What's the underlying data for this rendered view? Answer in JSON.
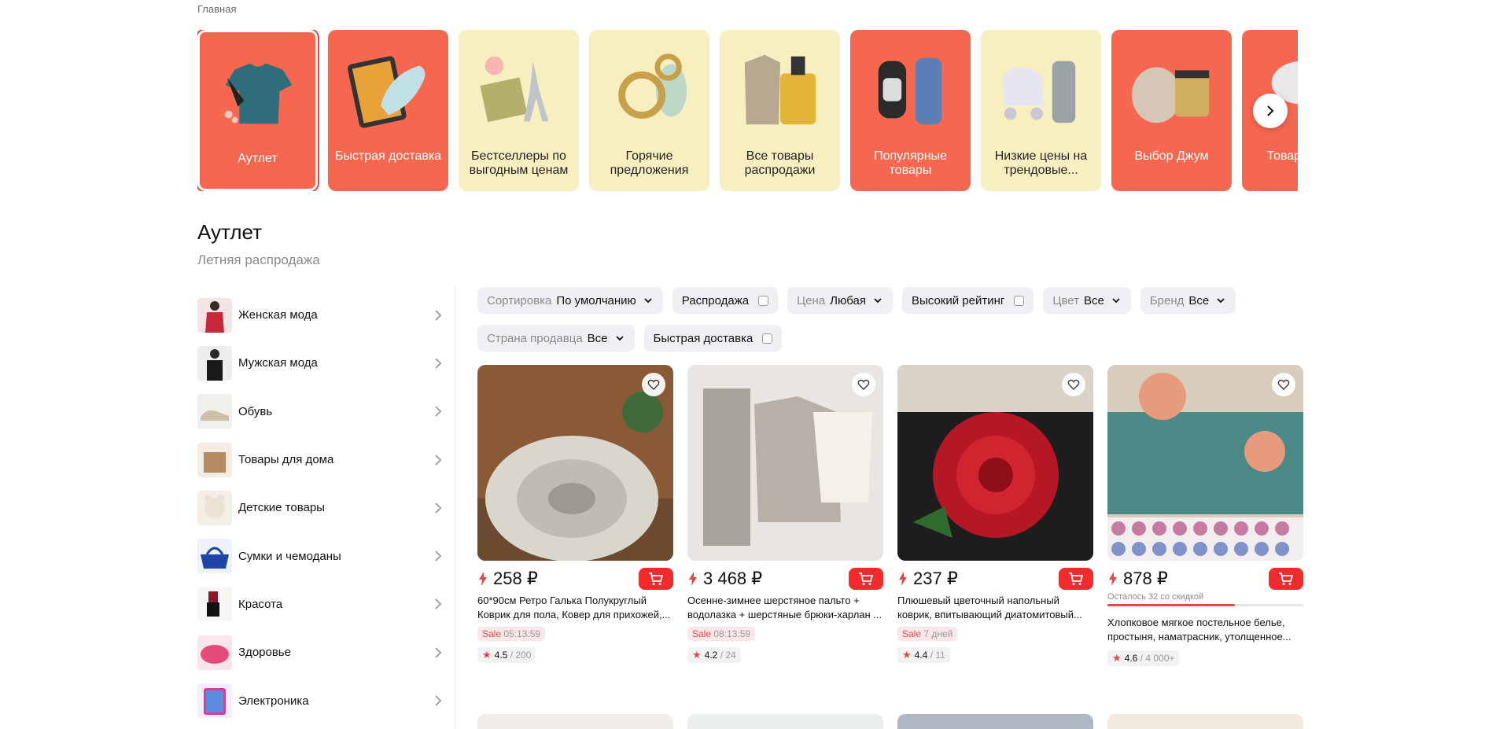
{
  "breadcrumb": "Главная",
  "tiles": [
    {
      "label": "Аутлет",
      "color": "red",
      "active": true
    },
    {
      "label": "Быстрая доставка",
      "color": "red"
    },
    {
      "label": "Бестселлеры по выгодным ценам",
      "color": "yellow"
    },
    {
      "label": "Горячие предложения",
      "color": "yellow"
    },
    {
      "label": "Все товары распродажи",
      "color": "yellow"
    },
    {
      "label": "Популярные товары",
      "color": "red"
    },
    {
      "label": "Низкие цены на трендовые...",
      "color": "yellow"
    },
    {
      "label": "Выбор Джум",
      "color": "red"
    },
    {
      "label": "Товар... ру...",
      "color": "red"
    }
  ],
  "page_title": "Аутлет",
  "page_subtitle": "Летняя распродажа",
  "sidebar": {
    "items": [
      {
        "label": "Женская мода",
        "icon": "women-fashion-icon"
      },
      {
        "label": "Мужская мода",
        "icon": "men-fashion-icon"
      },
      {
        "label": "Обувь",
        "icon": "shoes-icon"
      },
      {
        "label": "Товары для дома",
        "icon": "home-goods-icon"
      },
      {
        "label": "Детские товары",
        "icon": "kids-goods-icon"
      },
      {
        "label": "Сумки и чемоданы",
        "icon": "bags-icon"
      },
      {
        "label": "Красота",
        "icon": "beauty-icon"
      },
      {
        "label": "Здоровье",
        "icon": "health-icon"
      },
      {
        "label": "Электроника",
        "icon": "electronics-icon"
      }
    ]
  },
  "filters": {
    "sort": {
      "key": "Сортировка",
      "value": "По умолчанию"
    },
    "sale": {
      "label": "Распродажа"
    },
    "price": {
      "key": "Цена",
      "value": "Любая"
    },
    "high_rating": {
      "label": "Высокий рейтинг"
    },
    "color": {
      "key": "Цвет",
      "value": "Все"
    },
    "brand": {
      "key": "Бренд",
      "value": "Все"
    },
    "seller_country": {
      "key": "Страна продавца",
      "value": "Все"
    },
    "fast_delivery": {
      "label": "Быстрая доставка"
    }
  },
  "products": [
    {
      "price": "258 ₽",
      "title": "60*90см Ретро Галька Полукруглый Коврик для пола, Ковер для прихожей,...",
      "sale_label": "Sale",
      "sale_time": "05:13:59",
      "rating": "4.5",
      "reviews": "/ 200"
    },
    {
      "price": "3 468 ₽",
      "title": "Осенне-зимнее шерстяное пальто + водолазка + шерстяные брюки-харлан ...",
      "sale_label": "Sale",
      "sale_time": "08:13:59",
      "rating": "4.2",
      "reviews": "/ 24"
    },
    {
      "price": "237 ₽",
      "title": "Плюшевый цветочный напольный коврик, впитывающий диатомитовый...",
      "sale_label": "Sale",
      "sale_time": "7 дней",
      "rating": "4.4",
      "reviews": "/ 11"
    },
    {
      "price": "878 ₽",
      "stock_text": "Осталось 32 со скидкой",
      "stock_fraction": 0.65,
      "title": "Хлопковое мягкое постельное белье, простыня, наматрасник, утолщенное...",
      "rating": "4.6",
      "reviews": "/ 4 000+"
    }
  ],
  "colors": {
    "accent": "#f5674f",
    "accent_dark": "#e0462f",
    "tile_yellow": "#f7efc0",
    "cart_red": "#f02b2b",
    "sale_red": "#e34848"
  }
}
